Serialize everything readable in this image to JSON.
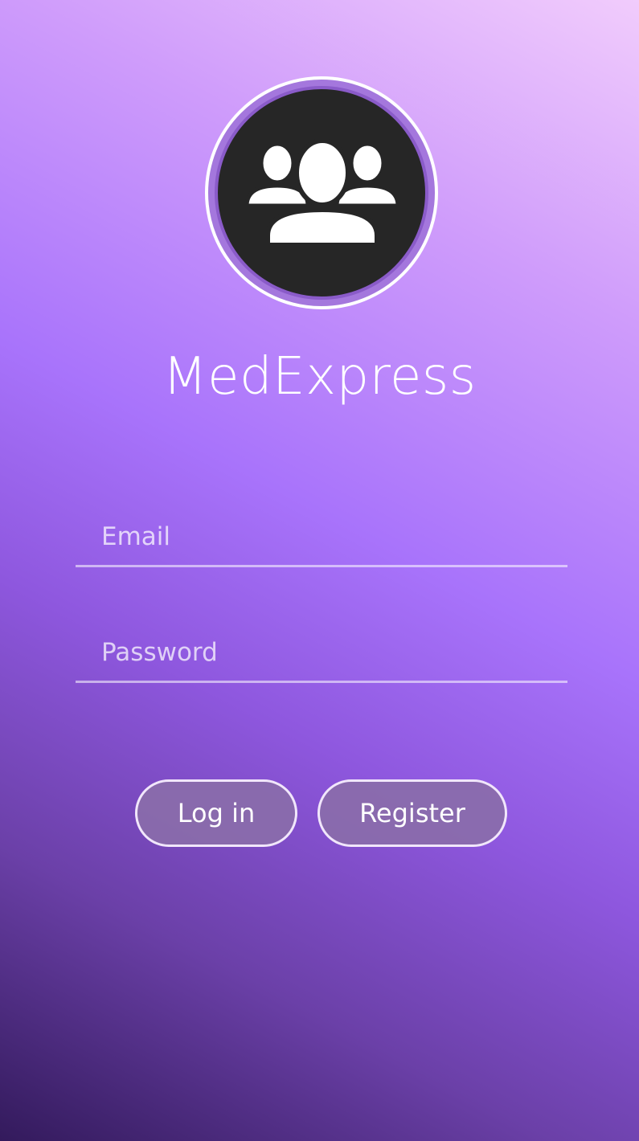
{
  "app": {
    "title": "MedExpress",
    "logo_icon": "users-group-icon"
  },
  "form": {
    "email_placeholder": "Email",
    "email_value": "",
    "password_placeholder": "Password",
    "password_value": ""
  },
  "actions": {
    "login_label": "Log in",
    "register_label": "Register"
  },
  "colors": {
    "gradient_light": "#f1ccfc",
    "gradient_mid": "#a873fb",
    "gradient_dark": "#331a5c",
    "avatar_bg": "#262626",
    "button_fill": "#8a6caa",
    "text": "#ffffff"
  }
}
